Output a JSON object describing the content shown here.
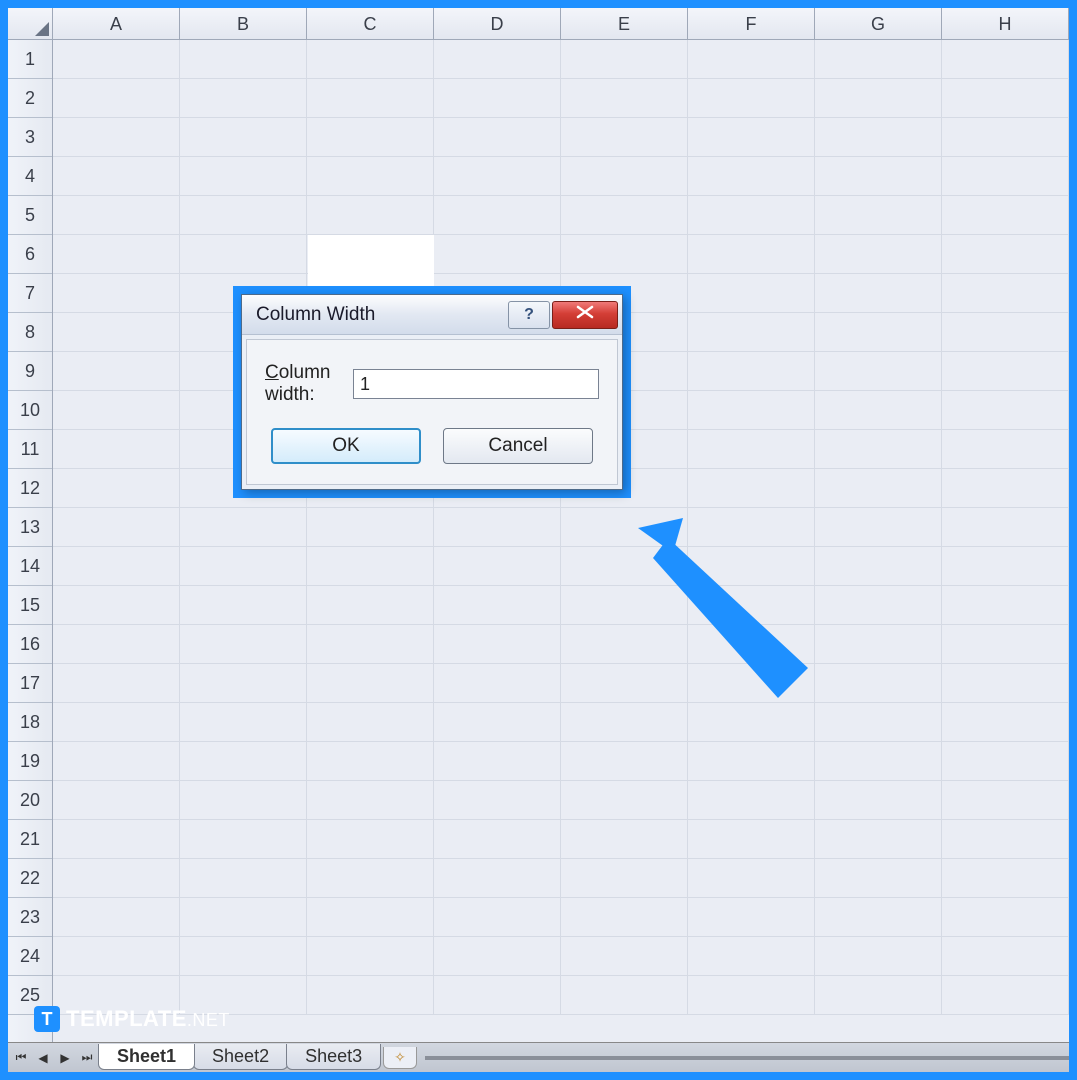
{
  "columns": [
    "A",
    "B",
    "C",
    "D",
    "E",
    "F",
    "G",
    "H"
  ],
  "rows": [
    "1",
    "2",
    "3",
    "4",
    "5",
    "6",
    "7",
    "8",
    "9",
    "10",
    "11",
    "12",
    "13",
    "14",
    "15",
    "16",
    "17",
    "18",
    "19",
    "20",
    "21",
    "22",
    "23",
    "24",
    "25"
  ],
  "tabs": {
    "items": [
      {
        "label": "Sheet1",
        "active": true
      },
      {
        "label": "Sheet2",
        "active": false
      },
      {
        "label": "Sheet3",
        "active": false
      }
    ]
  },
  "dialog": {
    "title": "Column Width",
    "field_label": "Column width:",
    "field_value": "1",
    "ok_label": "OK",
    "cancel_label": "Cancel"
  },
  "watermark": {
    "icon_letter": "T",
    "brand": "TEMPLATE",
    "tld": ".NET"
  }
}
